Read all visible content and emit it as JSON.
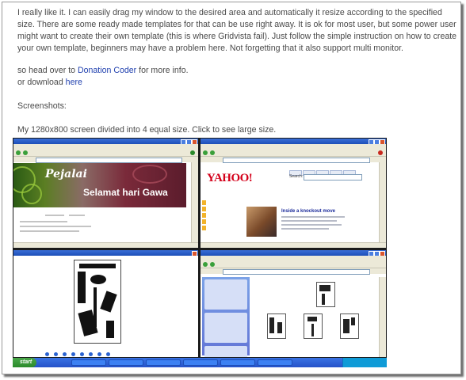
{
  "article": {
    "paragraph1": "I really like it. I can easily drag my window to the desired area and automatically it resize according to the specified size. There are some ready made templates for that can be use right away. It is ok for most user, but some power user might want to create their own template (this is where Gridvista fail). Just follow the simple instruction on how to create your own template, beginners may have a problem here. Not forgetting that it also support multi monitor.",
    "line2_prefix": "so head over to ",
    "line2_link": "Donation Coder",
    "line2_suffix": " for more info.",
    "line3_prefix": "or download ",
    "line3_link": "here",
    "screenshots_heading": "Screenshots:",
    "caption": "My 1280x800 screen divided into 4 equal size. Click to see large size."
  },
  "screenshot": {
    "q1": {
      "banner_title": "Pejalai",
      "banner_subtitle": "Selamat hari Gawa"
    },
    "q2": {
      "logo": "YAHOO!",
      "search_label": "Search:",
      "headline": "Inside a knockout move"
    },
    "taskbar": {
      "start_label": "start"
    },
    "colors": {
      "link": "#1f3fae",
      "text": "#4a4a4a",
      "xp_blue": "#2552c9"
    },
    "icons": [
      "window-close-icon",
      "browser-back-icon",
      "start-orb-icon"
    ]
  }
}
